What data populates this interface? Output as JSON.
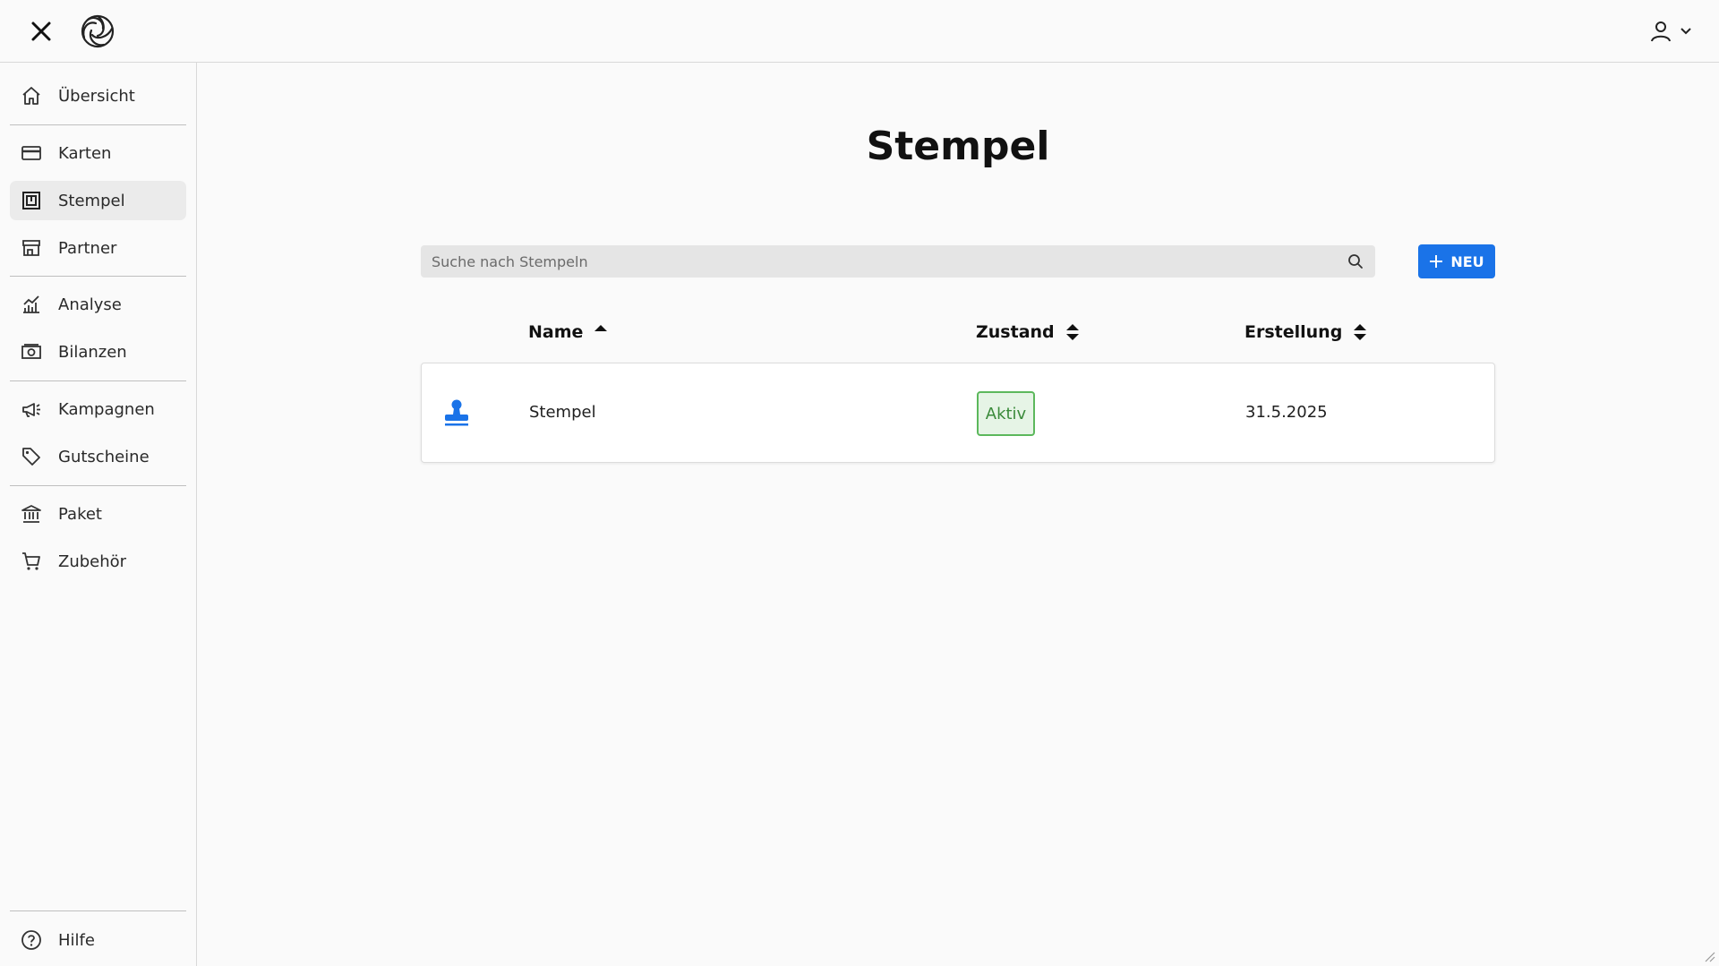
{
  "header": {
    "close_icon": "close-icon",
    "logo": "logo-icon",
    "user_icon": "user-icon"
  },
  "sidebar": {
    "items": [
      {
        "label": "Übersicht",
        "icon": "home-icon"
      },
      {
        "label": "Karten",
        "icon": "card-icon"
      },
      {
        "label": "Stempel",
        "icon": "stamp-icon",
        "active": true
      },
      {
        "label": "Partner",
        "icon": "store-icon"
      },
      {
        "label": "Analyse",
        "icon": "chart-icon"
      },
      {
        "label": "Bilanzen",
        "icon": "money-icon"
      },
      {
        "label": "Kampagnen",
        "icon": "megaphone-icon"
      },
      {
        "label": "Gutscheine",
        "icon": "tag-icon"
      },
      {
        "label": "Paket",
        "icon": "bank-icon"
      },
      {
        "label": "Zubehör",
        "icon": "cart-icon"
      }
    ],
    "help": {
      "label": "Hilfe",
      "icon": "help-icon"
    }
  },
  "main": {
    "title": "Stempel",
    "search": {
      "placeholder": "Suche nach Stempeln",
      "value": ""
    },
    "new_button": "NEU",
    "columns": {
      "name": "Name",
      "status": "Zustand",
      "created": "Erstellung"
    },
    "rows": [
      {
        "name": "Stempel",
        "status": "Aktiv",
        "created": "31.5.2025"
      }
    ]
  },
  "colors": {
    "accent": "#1a73e8",
    "active_badge_border": "#5cb85c",
    "active_badge_bg": "#e6f4e6"
  }
}
